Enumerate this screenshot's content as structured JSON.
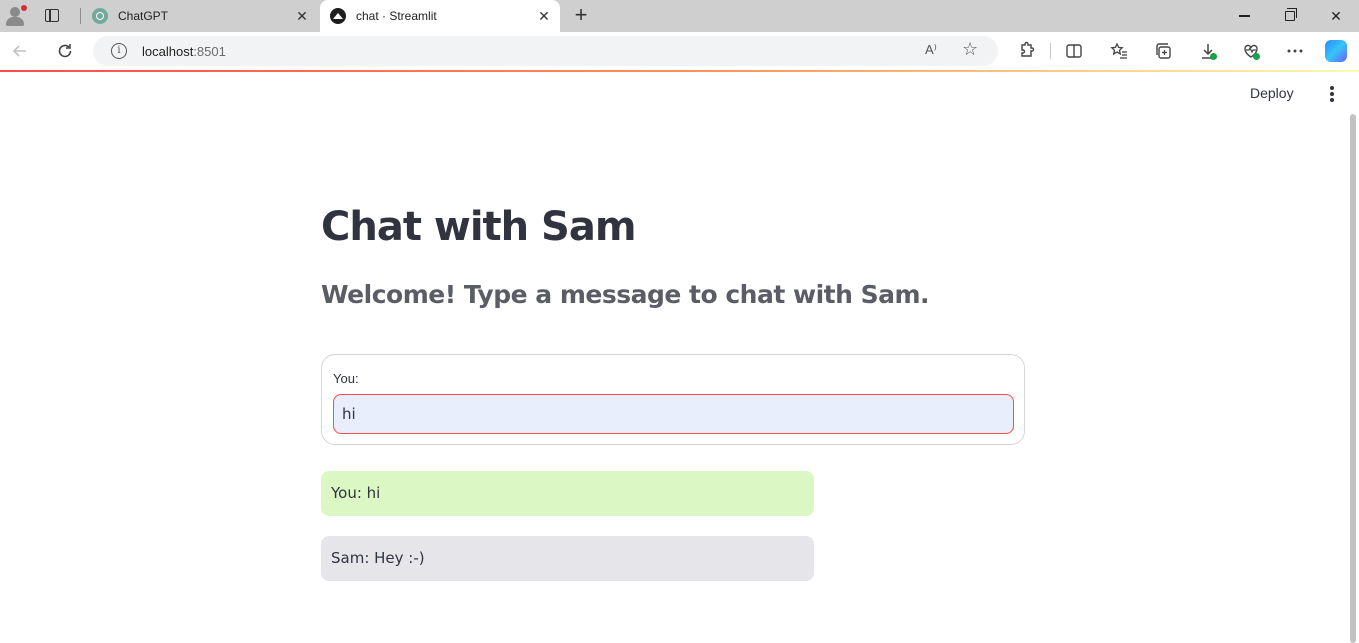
{
  "browser": {
    "tabs": [
      {
        "title": "ChatGPT",
        "favicon": "chatgpt-icon",
        "active": false
      },
      {
        "title": "chat · Streamlit",
        "favicon": "streamlit-icon",
        "active": true
      }
    ],
    "close_glyph": "✕",
    "new_tab_glyph": "+",
    "address": {
      "host": "localhost",
      "port": ":8501"
    },
    "read_aloud_glyph": "A⁾",
    "favorite_glyph": "☆",
    "window": {
      "minimize": "minimize-icon",
      "restore": "restore-icon",
      "close": "✕"
    }
  },
  "streamlit": {
    "deploy_label": "Deploy",
    "accent_gradient": [
      "#ff4b4b",
      "#ff8e5b",
      "#fff9b0"
    ]
  },
  "page": {
    "title": "Chat with Sam",
    "subtitle": "Welcome! Type a message to chat with Sam.",
    "form": {
      "label": "You:",
      "value": "hi"
    },
    "messages": [
      {
        "text": "You: hi",
        "role": "user",
        "color": "#dbf7c4"
      },
      {
        "text": "Sam: Hey :-)",
        "role": "bot",
        "color": "#e6e6ea"
      }
    ]
  }
}
